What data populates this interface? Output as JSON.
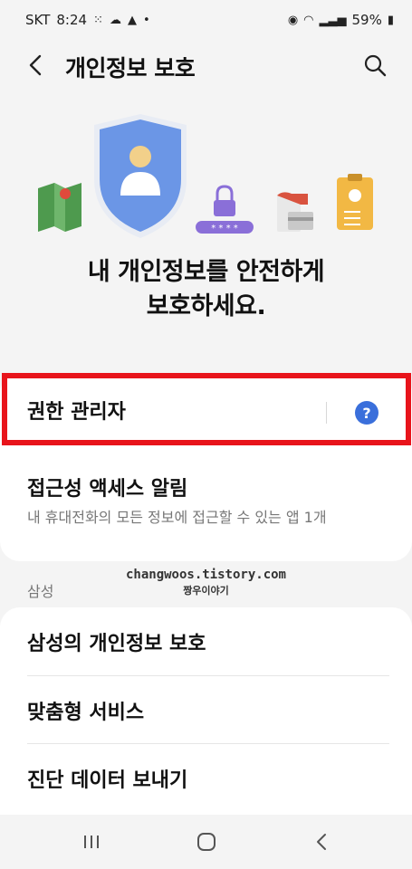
{
  "status": {
    "carrier": "SKT",
    "time": "8:24",
    "battery": "59%"
  },
  "header": {
    "title": "개인정보 보호"
  },
  "hero": {
    "headline_line1": "내 개인정보를 안전하게",
    "headline_line2": "보호하세요."
  },
  "card1": {
    "permission_manager": "권한 관리자",
    "help_glyph": "?",
    "accessibility_title": "접근성 액세스 알림",
    "accessibility_sub": "내 휴대전화의 모든 정보에 접근할 수 있는 앱 1개"
  },
  "watermark": {
    "line1": "changwoos.tistory.com",
    "line2": "짱우이야기"
  },
  "section": {
    "label": "삼성"
  },
  "samsung_items": [
    {
      "label": "삼성의 개인정보 보호"
    },
    {
      "label": "맞춤형 서비스"
    },
    {
      "label": "진단 데이터 보내기"
    }
  ],
  "colors": {
    "accent": "#3a6fdb",
    "highlight_border": "#e8141b",
    "shield": "#6b96e6"
  }
}
